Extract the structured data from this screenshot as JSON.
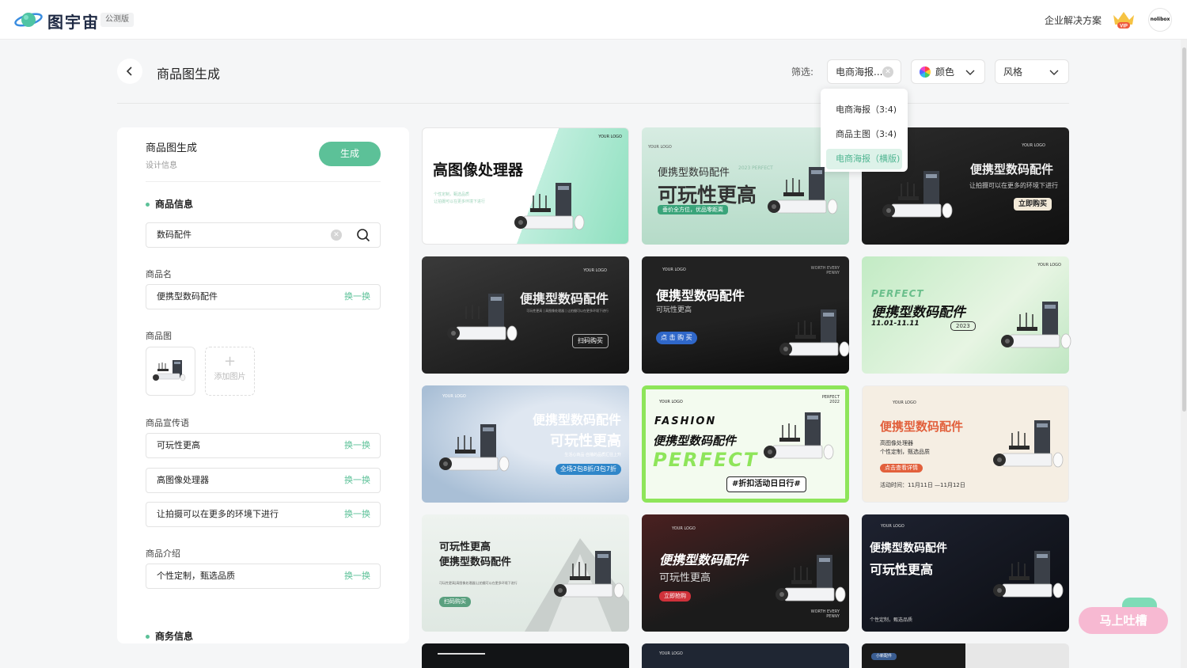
{
  "header": {
    "brand": "图宇宙",
    "beta_badge": "公测版",
    "enterprise_link": "企业解决方案",
    "vip_label": "VIP",
    "avatar_text": "nolibox"
  },
  "page": {
    "title": "商品图生成",
    "filter_label": "筛选:",
    "filters": {
      "type_value": "电商海报...",
      "color_label": "颜色",
      "style_label": "风格"
    },
    "dropdown_options": [
      "电商海报（3:4)",
      "商品主图（3:4)",
      "电商海报（横版)"
    ],
    "dropdown_selected": "电商海报（横版)"
  },
  "panel": {
    "title": "商品图生成",
    "subtitle": "设计信息",
    "generate_button": "生成",
    "section_product": "商品信息",
    "search_value": "数码配件",
    "name_label": "商品名",
    "name_value": "便携型数码配件",
    "swap_label": "换一换",
    "image_label": "商品图",
    "add_image_label": "添加图片",
    "slogan_label": "商品宣传语",
    "slogans": [
      "可玩性更高",
      "高图像处理器",
      "让拍摄可以在更多的环境下进行"
    ],
    "intro_label": "商品介绍",
    "intro_value": "个性定制，甄选品质",
    "section_business": "商务信息"
  },
  "cards": [
    {
      "title": "高图像处理器",
      "sub": "个性定制，甄选品质",
      "sub2": "让拍摄可以在更多环境下进行",
      "logo": "YOUR LOGO"
    },
    {
      "title": "便携型数码配件",
      "title2": "可玩性更高",
      "pill": "垂价全方位，优品零距离",
      "tag": "2023 PERFECT",
      "logo": "YOUR LOGO"
    },
    {
      "title": "便携型数码配件",
      "sub": "让拍摄可以在更多的环境下进行",
      "pill": "立即购买",
      "logo": "YOUR LOGO"
    },
    {
      "title": "便携型数码配件",
      "sub": "可玩性更高 | 高图像处理器 | 让拍摄可以在更多环境下进行",
      "pill": "扫码购买",
      "logo": "YOUR LOGO"
    },
    {
      "title": "便携型数码配件",
      "sub": "可玩性更高",
      "pill": "点 击 购 买",
      "tag": "WORTH EVERY PENNY",
      "logo": "YOUR LOGO"
    },
    {
      "title": "便携型数码配件",
      "title2": "PERFECT",
      "sub": "11.01-11.11",
      "tag": "2023",
      "logo": "YOUR LOGO"
    },
    {
      "title": "便携型数码配件",
      "title2": "可玩性更高",
      "sub": "生活心商品·自播的品质汇往上升",
      "pill": "全场2包8折/3包7折",
      "logo": "YOUR LOGO"
    },
    {
      "title": "FASHION",
      "title2": "便携型数码配件",
      "title3": "PERFECT",
      "pill": "#折扣活动日日行#",
      "tag": "PERFECT 2022",
      "logo": "YOUR LOGO"
    },
    {
      "title": "便携型数码配件",
      "sub": "高图像处理器",
      "sub2": "个性定制，甄选品质",
      "pill": "点击查看详情",
      "sub3": "活动时间：11月11日 —11月12日",
      "logo": "YOUR LOGO"
    },
    {
      "title": "可玩性更高",
      "title2": "便携型数码配件",
      "sub": "可玩性更高|高图像处理器|让拍摄可以在更多环境下进行",
      "pill": "扫码购买"
    },
    {
      "title": "便携型数码配件",
      "sub": "可玩性更高",
      "pill": "立即抢购",
      "tag": "WORTH EVERY PENNY",
      "logo": "YOUR LOGO"
    },
    {
      "title": "便携型数码配件",
      "title2": "可玩性更高",
      "sub": "个性定制，甄选品质",
      "logo": "YOUR LOGO"
    },
    {
      "logo": ""
    },
    {
      "logo": "YOUR LOGO"
    },
    {
      "logo": "小新配件"
    }
  ],
  "feedback_button": "马上吐槽",
  "colors": {
    "accent": "#5cc198",
    "dropdown_active_bg": "#ddf2e9"
  }
}
